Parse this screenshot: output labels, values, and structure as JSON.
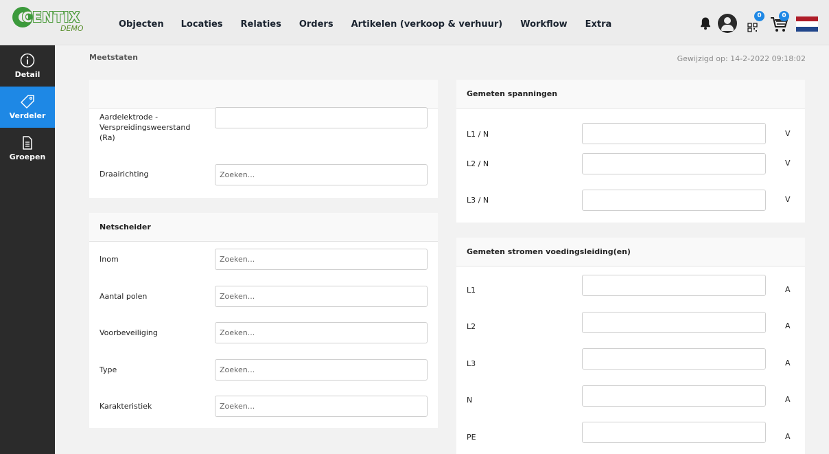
{
  "logo": {
    "brand": "CENTIX",
    "tag": "DEMO"
  },
  "nav": [
    "Objecten",
    "Locaties",
    "Relaties",
    "Orders",
    "Artikelen (verkoop & verhuur)",
    "Workflow",
    "Extra"
  ],
  "badges": {
    "qr": "0",
    "cart": "0"
  },
  "colors": {
    "accent": "#1e88e5",
    "sidebar": "#2b2b2b",
    "flag_red": "#ae1c28",
    "flag_white": "#ffffff",
    "flag_blue": "#21468b"
  },
  "sidebar": [
    {
      "label": "Detail",
      "icon": "info-icon",
      "active": false
    },
    {
      "label": "Verdeler",
      "icon": "tag-icon",
      "active": true
    },
    {
      "label": "Groepen",
      "icon": "document-icon",
      "active": false
    }
  ],
  "page": {
    "title": "Meetstaten",
    "modified": "Gewijzigd op: 14-2-2022 09:18:02"
  },
  "card_general": {
    "header": "",
    "rows": [
      {
        "label": "Aardelektrode - Verspreidingsweerstand (Ra)",
        "value": "",
        "placeholder": ""
      },
      {
        "label": "Draairichting",
        "value": "",
        "placeholder": "Zoeken..."
      }
    ]
  },
  "card_netscheider": {
    "header": "Netscheider",
    "rows": [
      {
        "label": "Inom",
        "placeholder": "Zoeken..."
      },
      {
        "label": "Aantal polen",
        "placeholder": "Zoeken..."
      },
      {
        "label": "Voorbeveiliging",
        "placeholder": "Zoeken..."
      },
      {
        "label": "Type",
        "placeholder": "Zoeken..."
      },
      {
        "label": "Karakteristiek",
        "placeholder": "Zoeken..."
      }
    ]
  },
  "card_spanningen": {
    "header": "Gemeten spanningen",
    "rows": [
      {
        "label": "L1 / N",
        "unit": "V",
        "value": ""
      },
      {
        "label": "L2 / N",
        "unit": "V",
        "value": ""
      },
      {
        "label": "L3 / N",
        "unit": "V",
        "value": ""
      }
    ]
  },
  "card_stromen": {
    "header": "Gemeten stromen voedingsleiding(en)",
    "rows": [
      {
        "label": "L1",
        "unit": "A",
        "value": ""
      },
      {
        "label": "L2",
        "unit": "A",
        "value": ""
      },
      {
        "label": "L3",
        "unit": "A",
        "value": ""
      },
      {
        "label": "N",
        "unit": "A",
        "value": ""
      },
      {
        "label": "PE",
        "unit": "A",
        "value": ""
      }
    ]
  }
}
